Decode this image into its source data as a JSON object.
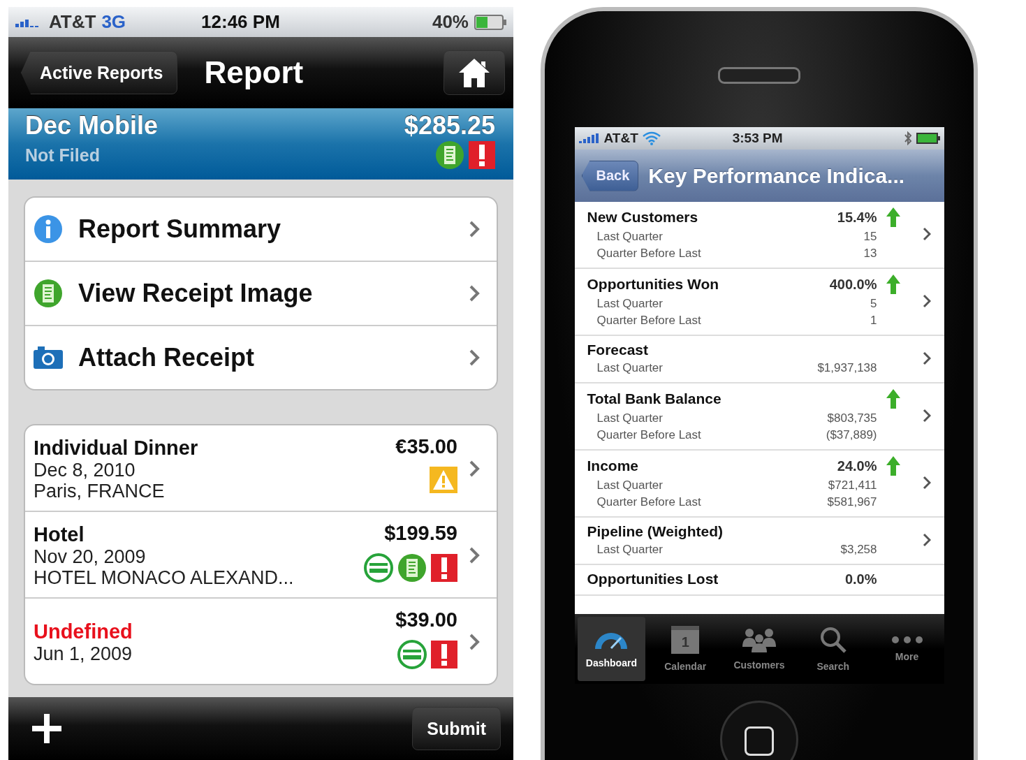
{
  "report_screen": {
    "status_bar": {
      "carrier": "AT&T",
      "network": "3G",
      "time": "12:46 PM",
      "battery": "40%"
    },
    "nav": {
      "back": "Active Reports",
      "title": "Report"
    },
    "report": {
      "name": "Dec Mobile",
      "amount": "$285.25",
      "status": "Not Filed",
      "flags": [
        {
          "kind": "receipt"
        },
        {
          "kind": "exception"
        }
      ]
    },
    "actions": [
      {
        "kind": "info",
        "label": "Report Summary"
      },
      {
        "kind": "receipt",
        "label": "View Receipt Image"
      },
      {
        "kind": "camera",
        "label": "Attach Receipt"
      }
    ],
    "expenses": [
      {
        "title": "Individual Dinner",
        "error": false,
        "date": "Dec 8, 2010",
        "location": "Paris, FRANCE",
        "amount": "€35.00",
        "flags": [
          {
            "kind": "warning"
          }
        ]
      },
      {
        "title": "Hotel",
        "error": false,
        "date": "Nov 20, 2009",
        "location": "HOTEL MONACO ALEXAND...",
        "amount": "$199.59",
        "flags": [
          {
            "kind": "card"
          },
          {
            "kind": "receipt"
          },
          {
            "kind": "exception"
          }
        ]
      },
      {
        "title": "Undefined",
        "error": true,
        "date": "Jun 1, 2009",
        "amount": "$39.00",
        "flags": [
          {
            "kind": "card"
          },
          {
            "kind": "exception"
          }
        ]
      }
    ],
    "toolbar": {
      "submit": "Submit"
    }
  },
  "kpi_screen": {
    "status_bar": {
      "carrier": "AT&T",
      "time": "3:53 PM"
    },
    "nav": {
      "back": "Back",
      "title": "Key Performance Indica..."
    },
    "kpis": [
      {
        "name": "New Customers",
        "change": "15.4%",
        "rising": true,
        "rows": [
          {
            "label": "Last Quarter",
            "value": "15"
          },
          {
            "label": "Quarter Before Last",
            "value": "13"
          }
        ]
      },
      {
        "name": "Opportunities Won",
        "change": "400.0%",
        "rising": true,
        "rows": [
          {
            "label": "Last Quarter",
            "value": "5"
          },
          {
            "label": "Quarter Before Last",
            "value": "1"
          }
        ]
      },
      {
        "name": "Forecast",
        "rows": [
          {
            "label": "Last Quarter",
            "value": "$1,937,138"
          }
        ]
      },
      {
        "name": "Total Bank Balance",
        "rising": true,
        "rows": [
          {
            "label": "Last Quarter",
            "value": "$803,735"
          },
          {
            "label": "Quarter Before Last",
            "value": "($37,889)"
          }
        ]
      },
      {
        "name": "Income",
        "change": "24.0%",
        "rising": true,
        "rows": [
          {
            "label": "Last Quarter",
            "value": "$721,411"
          },
          {
            "label": "Quarter Before Last",
            "value": "$581,967"
          }
        ]
      },
      {
        "name": "Pipeline (Weighted)",
        "rows": [
          {
            "label": "Last Quarter",
            "value": "$3,258"
          }
        ]
      },
      {
        "name": "Opportunities Lost",
        "change": "0.0%"
      }
    ],
    "tabs": [
      {
        "kind": "gauge",
        "label": "Dashboard",
        "selected": true
      },
      {
        "kind": "calendar",
        "label": "Calendar",
        "icon_text": "1",
        "selected": false
      },
      {
        "kind": "people",
        "label": "Customers",
        "selected": false
      },
      {
        "kind": "search",
        "label": "Search",
        "selected": false
      },
      {
        "kind": "more",
        "label": "More",
        "selected": false
      }
    ]
  }
}
